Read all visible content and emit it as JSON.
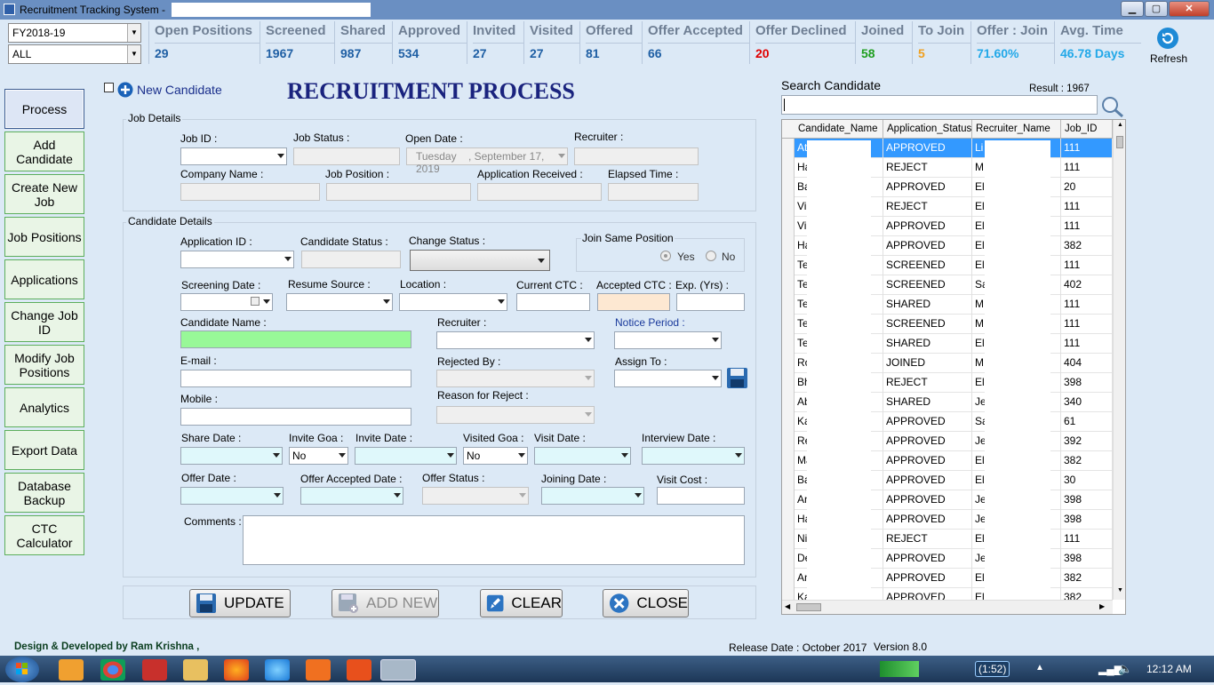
{
  "window": {
    "title": "Recruitment Tracking System  -",
    "min": "▁",
    "max": "▢",
    "close": "✕"
  },
  "filters": {
    "year": "FY2018-19",
    "scope": "ALL"
  },
  "stats": [
    {
      "label": "Open Positions",
      "value": "29",
      "color": "#1f5fa4"
    },
    {
      "label": "Screened",
      "value": "1967",
      "color": "#1f5fa4"
    },
    {
      "label": "Shared",
      "value": "987",
      "color": "#1f5fa4"
    },
    {
      "label": "Approved",
      "value": "534",
      "color": "#1f5fa4"
    },
    {
      "label": "Invited",
      "value": "27",
      "color": "#1f5fa4"
    },
    {
      "label": "Visited",
      "value": "27",
      "color": "#1f5fa4"
    },
    {
      "label": "Offered",
      "value": "81",
      "color": "#1f5fa4"
    },
    {
      "label": "Offer Accepted",
      "value": "66",
      "color": "#1f5fa4"
    },
    {
      "label": "Offer Declined",
      "value": "20",
      "color": "#e00000"
    },
    {
      "label": "Joined",
      "value": "58",
      "color": "#1e9e1e"
    },
    {
      "label": "To Join",
      "value": "5",
      "color": "#f0a020"
    },
    {
      "label": "Offer : Join",
      "value": "71.60%",
      "color": "#22a8e8"
    },
    {
      "label": "Avg. Time",
      "value": "46.78 Days",
      "color": "#22a8e8"
    }
  ],
  "refresh_label": "Refresh",
  "nav": [
    "Process",
    "Add Candidate",
    "Create New Job",
    "Job Positions",
    "Applications",
    "Change Job ID",
    "Modify Job Positions",
    "Analytics",
    "Export Data",
    "Database Backup",
    "CTC Calculator"
  ],
  "form": {
    "new_candidate": "New Candidate",
    "heading": "RECRUITMENT PROCESS",
    "job_details": "Job Details",
    "job_id": "Job ID :",
    "job_status": "Job Status :",
    "open_date": "Open Date :",
    "open_date_day": "Tuesday",
    "open_date_val": ", September 17, 2019",
    "recruiter_top": "Recruiter :",
    "company_name": "Company Name :",
    "job_position": "Job Position :",
    "application_received": "Application Received :",
    "elapsed_time": "Elapsed Time :",
    "candidate_details": "Candidate Details",
    "application_id": "Application ID :",
    "candidate_status": "Candidate Status :",
    "change_status": "Change Status :",
    "join_same_position": "Join Same Position",
    "yes": "Yes",
    "no": "No",
    "screening_date": "Screening Date :",
    "resume_source": "Resume Source :",
    "location": "Location :",
    "current_ctc": "Current CTC :",
    "accepted_ctc": "Accepted CTC :",
    "exp_yrs": "Exp. (Yrs) :",
    "candidate_name": "Candidate Name :",
    "recruiter": "Recruiter :",
    "notice_period": "Notice Period :",
    "email": "E-mail :",
    "rejected_by": "Rejected By :",
    "assign_to": "Assign To :",
    "mobile": "Mobile :",
    "reason_for_reject": "Reason for Reject :",
    "share_date": "Share Date :",
    "invite_goa": "Invite Goa :",
    "invite_goa_val": "No",
    "invite_date": "Invite Date :",
    "visited_goa": "Visited Goa :",
    "visited_goa_val": "No",
    "visit_date": "Visit Date :",
    "interview_date": "Interview Date :",
    "offer_date": "Offer Date :",
    "offer_accepted_date": "Offer Accepted Date :",
    "offer_status": "Offer Status :",
    "joining_date": "Joining Date :",
    "visit_cost": "Visit Cost :",
    "comments": "Comments :"
  },
  "buttons": {
    "update": "UPDATE",
    "add_new": "ADD NEW",
    "clear": "CLEAR",
    "close": "CLOSE"
  },
  "search": {
    "label": "Search Candidate",
    "result": "Result :  1967"
  },
  "grid": {
    "columns": [
      "Candidate_Name",
      "Application_Status",
      "Recruiter_Name",
      "Job_ID"
    ],
    "rows": [
      [
        "Ati",
        "APPROVED",
        "Li",
        "111"
      ],
      [
        "Ha",
        "REJECT",
        "M",
        "111"
      ],
      [
        "Ba",
        "APPROVED",
        "El",
        "20"
      ],
      [
        "Vi",
        "REJECT",
        "El",
        "111"
      ],
      [
        "Vi",
        "APPROVED",
        "El",
        "111"
      ],
      [
        "Ha",
        "APPROVED",
        "El",
        "382"
      ],
      [
        "Te",
        "SCREENED",
        "El",
        "111"
      ],
      [
        "Te",
        "SCREENED",
        "Sa",
        "402"
      ],
      [
        "Te",
        "SHARED",
        "M",
        "111"
      ],
      [
        "Te",
        "SCREENED",
        "M",
        "111"
      ],
      [
        "Te",
        "SHARED",
        "El",
        "111"
      ],
      [
        "Ro",
        "JOINED",
        "M",
        "404"
      ],
      [
        "Bh",
        "REJECT",
        "El",
        "398"
      ],
      [
        "Ab",
        "SHARED",
        "Je",
        "340"
      ],
      [
        "Ka",
        "APPROVED",
        "Sa",
        "61"
      ],
      [
        "Re",
        "APPROVED",
        "Je",
        "392"
      ],
      [
        "Ma",
        "APPROVED",
        "El",
        "382"
      ],
      [
        "Ba",
        "APPROVED",
        "El",
        "30"
      ],
      [
        "An",
        "APPROVED",
        "Je",
        "398"
      ],
      [
        "Ha",
        "APPROVED",
        "Je",
        "398"
      ],
      [
        "Ni",
        "REJECT",
        "El",
        "111"
      ],
      [
        "De",
        "APPROVED",
        "Je",
        "398"
      ],
      [
        "An",
        "APPROVED",
        "El",
        "382"
      ],
      [
        "Ka",
        "APPROVED",
        "El",
        "382"
      ]
    ]
  },
  "footer": {
    "credit": "Design & Developed by Ram Krishna ,",
    "release": "Release Date : October 2017",
    "version": "Version 8.0"
  },
  "taskbar": {
    "battery": "(1:52)",
    "clock": "12:12 AM"
  }
}
